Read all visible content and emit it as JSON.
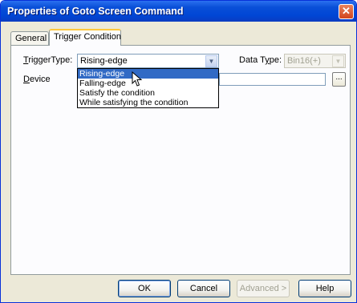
{
  "window": {
    "title": "Properties of Goto Screen Command",
    "close_glyph": "✕"
  },
  "tabs": [
    {
      "label": "General",
      "active": false
    },
    {
      "label": "Trigger Condition",
      "active": true
    }
  ],
  "trigger_type": {
    "label_mnemonic": "T",
    "label_rest": "riggerType:",
    "value": "Rising-edge",
    "options": [
      "Rising-edge",
      "Falling-edge",
      "Satisfy the condition",
      "While satisfying the condition"
    ],
    "selected_index": 0
  },
  "data_type": {
    "label_pre": "Data T",
    "label_mnemonic": "y",
    "label_post": "pe:",
    "value": "Bin16(+)",
    "disabled": true
  },
  "device": {
    "label_mnemonic": "D",
    "label_rest": "evice",
    "value": "",
    "browse_label": "..."
  },
  "buttons": {
    "ok": "OK",
    "cancel": "Cancel",
    "advanced": "Advanced >",
    "help": "Help"
  },
  "icons": {
    "dropdown_arrow": "chevron-down-icon",
    "cursor": "mouse-pointer-icon"
  }
}
